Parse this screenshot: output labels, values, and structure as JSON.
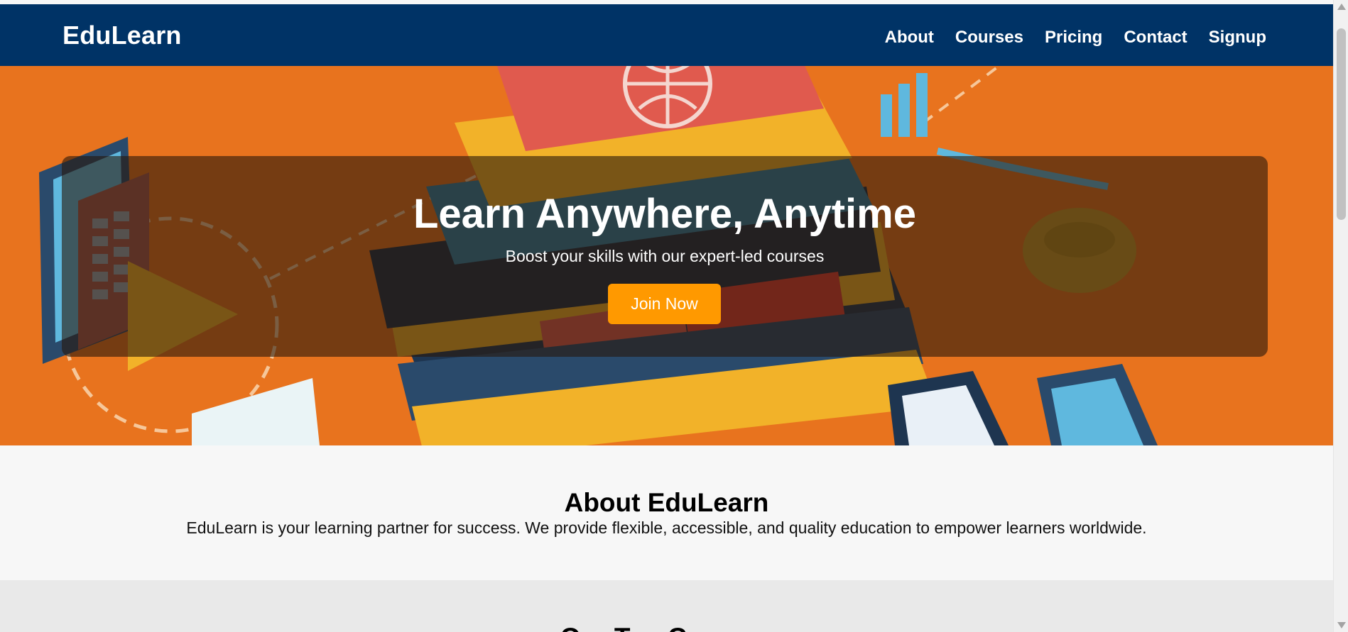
{
  "header": {
    "logo": "EduLearn",
    "nav": [
      {
        "label": "About"
      },
      {
        "label": "Courses"
      },
      {
        "label": "Pricing"
      },
      {
        "label": "Contact"
      },
      {
        "label": "Signup"
      }
    ]
  },
  "hero": {
    "title": "Learn Anywhere, Anytime",
    "subtitle": "Boost your skills with our expert-led courses",
    "cta_label": "Join Now",
    "background_icon": "education-illustration-icon"
  },
  "about": {
    "heading": "About EduLearn",
    "text": "EduLearn is your learning partner for success. We provide flexible, accessible, and quality education to empower learners worldwide."
  },
  "courses": {
    "heading": "Our Top Courses"
  },
  "colors": {
    "header_bg": "#003366",
    "hero_bg": "#e8731e",
    "cta_bg": "#ff9900",
    "about_bg": "#f7f7f7",
    "courses_bg": "#e9e9e9"
  }
}
